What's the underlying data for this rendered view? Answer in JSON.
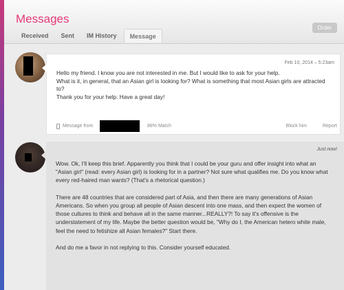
{
  "header": {
    "title": "Messages",
    "order_label": "Order",
    "tabs": [
      {
        "label": "Received"
      },
      {
        "label": "Sent"
      },
      {
        "label": "IM History"
      },
      {
        "label": "Message"
      }
    ]
  },
  "messages": [
    {
      "date": "Feb 10, 2014 – 5:23am",
      "lines": [
        "Hello my friend. I know you are not interested in me. But I would like to ask for your help.",
        "What is it, in general, that an Asian girl is looking for? What is something that most Asian girls are attracted to?",
        "Thank you for your help. Have a great day!"
      ],
      "message_from": "Message from",
      "match": "88% Match",
      "block_label": "Block him",
      "report_label": "Report"
    },
    {
      "date": "Just now!",
      "paragraphs": [
        "Wow. Ok, I'll keep this brief. Apparently you think that I could be your guru and offer insight into what an \"Asian girl\" (read: every Asian girl) is looking for in a partner? Not sure what qualifies me. Do you know what every red-haired man wants? (That's a rhetorical question.)",
        "There are 48 countries that are considered part of Asia, and then there are many generations of Asian Americans. So when you group all people of Asian descent into one mass, and then expect the women of those cultures to think and behave all in the same manner...REALLY?! To say it's offensive is the understatement of my life. Maybe the better question would be, \"Why do I, the American hetero white male, feel the need to fetishize all Asian females?\" Start there.",
        "And do me a favor in not replying to this. Consider yourself educated."
      ]
    }
  ]
}
